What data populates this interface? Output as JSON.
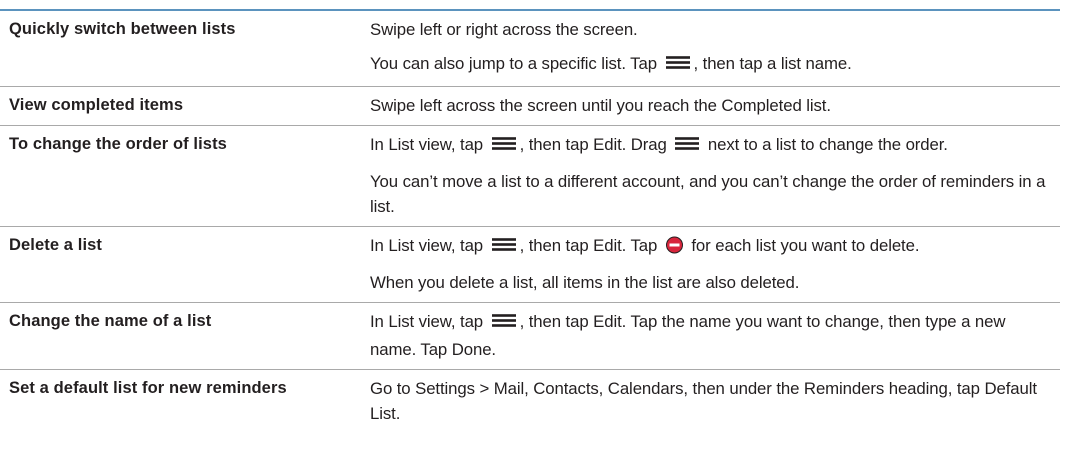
{
  "rows": [
    {
      "action": "Quickly switch between lists",
      "paragraphs": [
        [
          {
            "t": "Swipe left or right across the screen."
          }
        ],
        [
          {
            "t": "You can also jump to a specific list. Tap "
          },
          {
            "icon": "list-menu-icon"
          },
          {
            "t": ", then tap a list name."
          }
        ]
      ]
    },
    {
      "action": "View completed items",
      "paragraphs": [
        [
          {
            "t": "Swipe left across the screen until you reach the Completed list."
          }
        ]
      ]
    },
    {
      "action": "To change the order of lists",
      "paragraphs": [
        [
          {
            "t": "In List view, tap "
          },
          {
            "icon": "list-menu-icon"
          },
          {
            "t": ", then tap Edit. Drag "
          },
          {
            "icon": "reorder-handle-icon"
          },
          {
            "t": " next to a list to change the order."
          }
        ],
        [
          {
            "t": "You can’t move a list to a different account, and you can’t change the order of reminders in a list."
          }
        ]
      ]
    },
    {
      "action": "Delete a list",
      "paragraphs": [
        [
          {
            "t": "In List view, tap "
          },
          {
            "icon": "list-menu-icon"
          },
          {
            "t": ", then tap Edit. Tap "
          },
          {
            "icon": "delete-icon"
          },
          {
            "t": " for each list you want to delete."
          }
        ],
        [
          {
            "t": "When you delete a list, all items in the list are also deleted."
          }
        ]
      ]
    },
    {
      "action": "Change the name of a list",
      "paragraphs": [
        [
          {
            "t": "In List view, tap "
          },
          {
            "icon": "list-menu-icon"
          },
          {
            "t": ", then tap Edit. Tap the name you want to change, then type a new name. Tap Done."
          }
        ]
      ]
    },
    {
      "action": "Set a default list for new reminders",
      "paragraphs": [
        [
          {
            "t": "Go to Settings > Mail, Contacts, Calendars, then under the Reminders heading, tap Default List."
          }
        ]
      ]
    }
  ],
  "colors": {
    "text": "#231f20",
    "top_rule": "#5b93be",
    "row_rule": "#a9a9a9",
    "delete_icon": "#d8253c"
  }
}
